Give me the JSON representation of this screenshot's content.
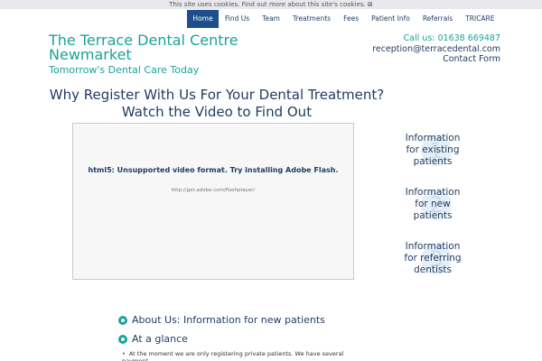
{
  "cookie_bar": {
    "text": "This site uses cookies. Find out more about this site's cookies. ⊠"
  },
  "nav": {
    "items": [
      "Home",
      "Find Us",
      "Team",
      "Treatments",
      "Fees",
      "Patient Info",
      "Referrals",
      "TRICARE"
    ],
    "active": "Home"
  },
  "brand": {
    "title": "The Terrace Dental Centre Newmarket",
    "tagline": "Tomorrow's Dental Care Today"
  },
  "contact": {
    "phone": "Call us: 01638 669487",
    "email": "reception@terracedental.com",
    "form_link": "Contact Form"
  },
  "headline": {
    "line1": "Why Register With Us For Your Dental Treatment?",
    "line2": "Watch the Video to Find Out"
  },
  "video": {
    "message": "html5: Unsupported video format. Try installing Adobe Flash.",
    "link": "http://get.adobe.com/flashplayer/"
  },
  "side_links": [
    {
      "text": "Information for existing patients",
      "icon": "tooth-number-1-icon"
    },
    {
      "text": "Information for new patients",
      "icon": "tooth-number-2-icon"
    },
    {
      "text": "Information for referring dentists",
      "icon": "tooth-number-3-icon"
    }
  ],
  "sections": {
    "about": "About Us: Information for new patients",
    "glance": "At a glance"
  },
  "list": {
    "item1": "At the moment we are only registering private patients. We have several payment"
  },
  "colors": {
    "accent": "#1aa39a",
    "navy": "#1f3a5f",
    "nav_active": "#1f4e8c"
  }
}
